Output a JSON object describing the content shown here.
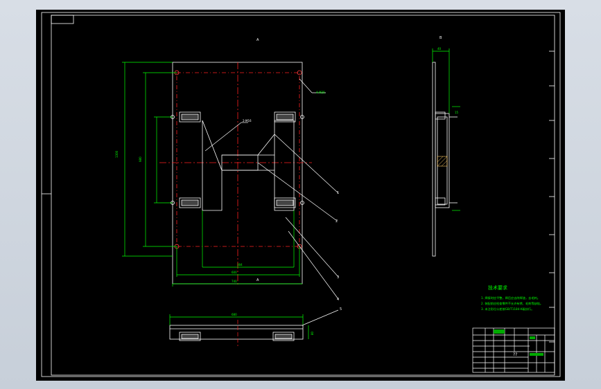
{
  "drawing": {
    "view_label_top": "A",
    "view_label_side": "B",
    "callouts": [
      "1",
      "2",
      "3",
      "4",
      "5"
    ],
    "hole_note": "4-M20",
    "dim_note": "2-M16",
    "dims": {
      "overall_height": "1300",
      "inner_height": "980",
      "width_bottom": "600",
      "overall_width": "740",
      "inner_gap": "384",
      "front_length": "680",
      "front_height": "80",
      "side_top": "40",
      "side_right": "15"
    }
  },
  "technical_requirements": {
    "title": "技术要求",
    "items": [
      "1. 焊接时应平整，焊后应去除焊渣，去毛刺。",
      "2. 装配前应检查零件不允许有锈、毛刺等缺陷。",
      "3. 未注形位公差按GB/T1184-K级执行。"
    ]
  },
  "title_block": {
    "placeholder": "??"
  },
  "colors": {
    "paper_bg": "#000000",
    "frame": "#ffffff",
    "dimension": "#00ff00",
    "centerline": "#ff2020",
    "text_note": "#00ff00"
  }
}
